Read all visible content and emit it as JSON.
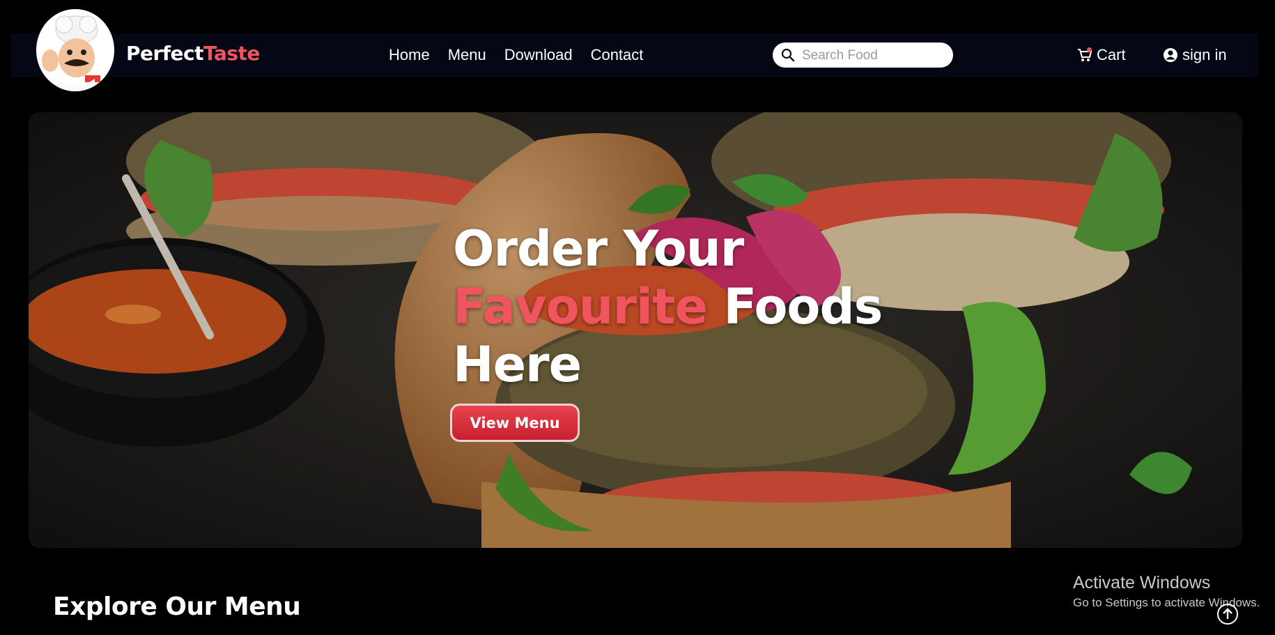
{
  "brand": {
    "name_part1": "Perfect",
    "name_part2": "Taste"
  },
  "nav": {
    "links": [
      "Home",
      "Menu",
      "Download",
      "Contact"
    ],
    "search_placeholder": "Search Food",
    "cart_label": "Cart",
    "signin_label": "sign in"
  },
  "hero": {
    "line1": "Order Your",
    "line2_accent": "Favourite",
    "line2_rest": "Foods",
    "line3": "Here",
    "button_label": "View Menu"
  },
  "section_title": "Explore Our Menu",
  "os_watermark": {
    "title": "Activate Windows",
    "subtitle": "Go to Settings to activate Windows."
  },
  "icons": {
    "search": "search-icon",
    "cart": "cart-icon",
    "user": "user-circle-icon",
    "scroll_top": "arrow-up-circle-icon"
  },
  "colors": {
    "accent": "#f0555f",
    "navbar": "#050814",
    "background": "#000000",
    "button": "#d92b3a"
  }
}
